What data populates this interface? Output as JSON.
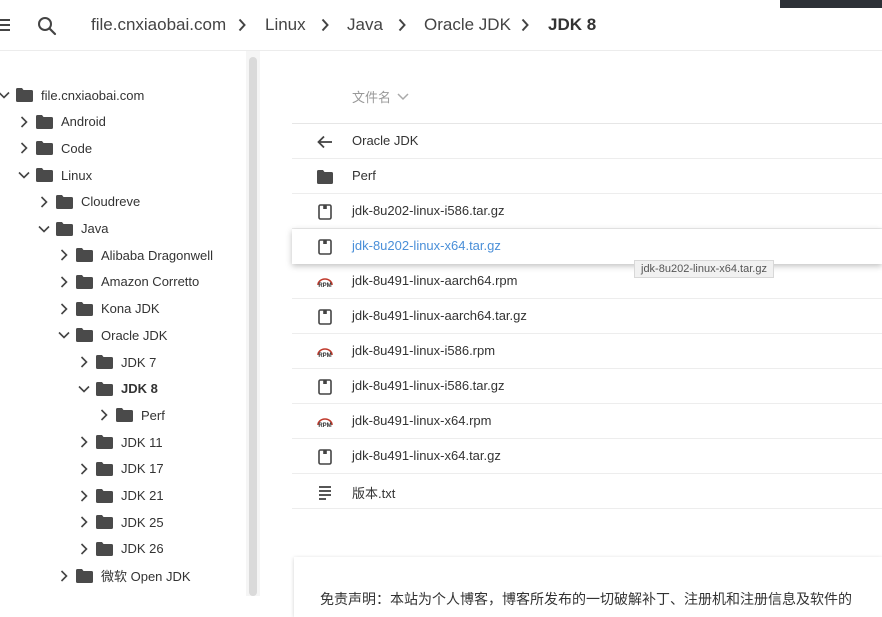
{
  "breadcrumb": {
    "items": [
      "file.cnxiaobai.com",
      "Linux",
      "Java",
      "Oracle JDK",
      "JDK 8"
    ]
  },
  "sidebar": {
    "items": [
      {
        "label": "file.cnxiaobai.com",
        "level": 0,
        "expanded": true
      },
      {
        "label": "Android",
        "level": 1,
        "expanded": false
      },
      {
        "label": "Code",
        "level": 1,
        "expanded": false
      },
      {
        "label": "Linux",
        "level": 1,
        "expanded": true
      },
      {
        "label": "Cloudreve",
        "level": 2,
        "expanded": false
      },
      {
        "label": "Java",
        "level": 2,
        "expanded": true
      },
      {
        "label": "Alibaba Dragonwell",
        "level": 3,
        "expanded": false
      },
      {
        "label": "Amazon Corretto",
        "level": 3,
        "expanded": false
      },
      {
        "label": "Kona JDK",
        "level": 3,
        "expanded": false
      },
      {
        "label": "Oracle JDK",
        "level": 3,
        "expanded": true
      },
      {
        "label": "JDK 7",
        "level": 4,
        "expanded": false
      },
      {
        "label": "JDK 8",
        "level": 4,
        "expanded": true,
        "selected": true
      },
      {
        "label": "Perf",
        "level": 5,
        "expanded": false
      },
      {
        "label": "JDK 11",
        "level": 4,
        "expanded": false
      },
      {
        "label": "JDK 17",
        "level": 4,
        "expanded": false
      },
      {
        "label": "JDK 21",
        "level": 4,
        "expanded": false
      },
      {
        "label": "JDK 25",
        "level": 4,
        "expanded": false
      },
      {
        "label": "JDK 26",
        "level": 4,
        "expanded": false
      },
      {
        "label": "微软 Open JDK",
        "level": 3,
        "expanded": false
      }
    ]
  },
  "list": {
    "header": "文件名",
    "rows": [
      {
        "name": "Oracle JDK",
        "icon": "back-arrow-icon"
      },
      {
        "name": "Perf",
        "icon": "folder-icon"
      },
      {
        "name": "jdk-8u202-linux-i586.tar.gz",
        "icon": "file-icon"
      },
      {
        "name": "jdk-8u202-linux-x64.tar.gz",
        "icon": "file-icon",
        "selected": true
      },
      {
        "name": "jdk-8u491-linux-aarch64.rpm",
        "icon": "rpm-icon"
      },
      {
        "name": "jdk-8u491-linux-aarch64.tar.gz",
        "icon": "file-icon"
      },
      {
        "name": "jdk-8u491-linux-i586.rpm",
        "icon": "rpm-icon"
      },
      {
        "name": "jdk-8u491-linux-i586.tar.gz",
        "icon": "file-icon"
      },
      {
        "name": "jdk-8u491-linux-x64.rpm",
        "icon": "rpm-icon"
      },
      {
        "name": "jdk-8u491-linux-x64.tar.gz",
        "icon": "file-icon"
      },
      {
        "name": "版本.txt",
        "icon": "text-file-icon"
      }
    ]
  },
  "tooltip": "jdk-8u202-linux-x64.tar.gz",
  "disclaimer": "免责声明：本站为个人博客，博客所发布的一切破解补丁、注册机和注册信息及软件的",
  "colors": {
    "accent": "#4a8fd8",
    "topbar_dark": "#2d3137"
  }
}
